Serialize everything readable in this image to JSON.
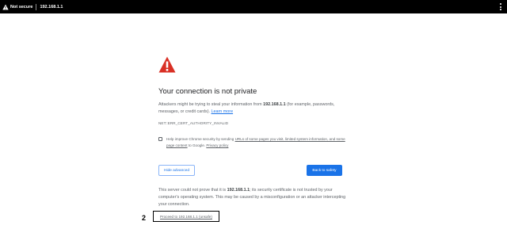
{
  "toolbar": {
    "security_chip": "Not secure",
    "url": "192.168.1.1"
  },
  "interstitial": {
    "heading": "Your connection is not private",
    "desc_pre": "Attackers might be trying to steal your information from ",
    "desc_host": "192.168.1.1",
    "desc_post": " (for example, passwords, messages, or credit cards). ",
    "learn_more": "Learn more",
    "error_code": "NET::ERR_CERT_AUTHORITY_INVALID",
    "checkbox_pre": "Help improve Chrome security by sending ",
    "checkbox_link1": "URLs of some pages you visit, limited system information, and some page content",
    "checkbox_mid": " to Google. ",
    "checkbox_link2": "Privacy policy",
    "hide_advanced": "Hide advanced",
    "back_to_safety": "Back to safety",
    "detail_pre": "This server could not prove that it is ",
    "detail_host": "192.168.1.1",
    "detail_post": "; its security certificate is not trusted by your computer's operating system. This may be caused by a misconfiguration or an attacker intercepting your connection.",
    "proceed_link": "Proceed to 192.168.1.1 (unsafe)"
  },
  "annotation": {
    "number": "2"
  },
  "colors": {
    "topbar": "#000000",
    "warning_red": "#d93025",
    "link_blue": "#1a73e8",
    "text_grey": "#5f6368"
  },
  "icons": {
    "chip": "warning-triangle-icon",
    "page": "warning-triangle-icon",
    "menu": "more-vert-icon"
  }
}
